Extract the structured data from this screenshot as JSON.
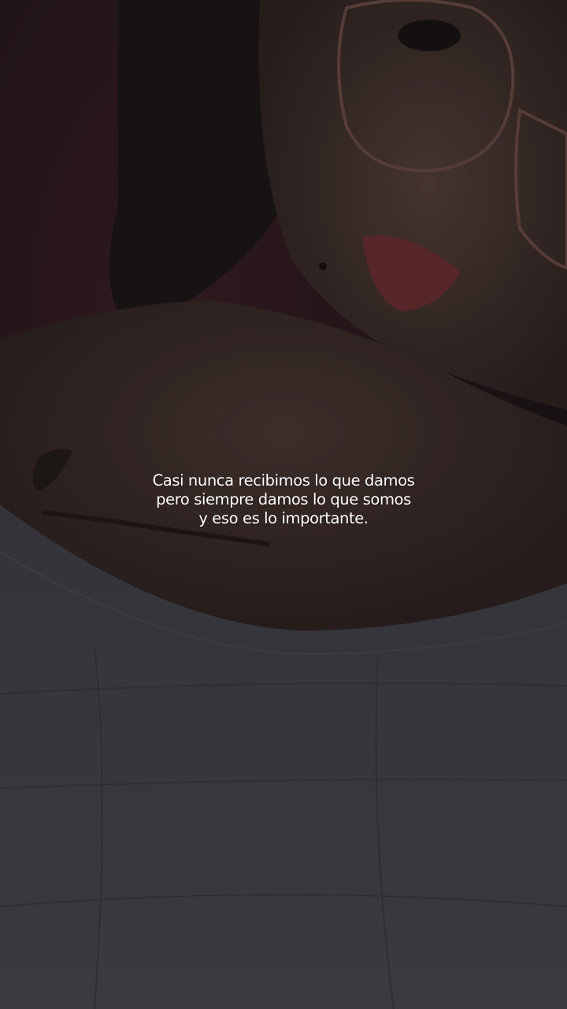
{
  "story": {
    "caption_lines": [
      "Casi nunca recibimos lo que damos",
      "pero siempre damos lo que somos",
      "y eso es lo importante."
    ]
  }
}
